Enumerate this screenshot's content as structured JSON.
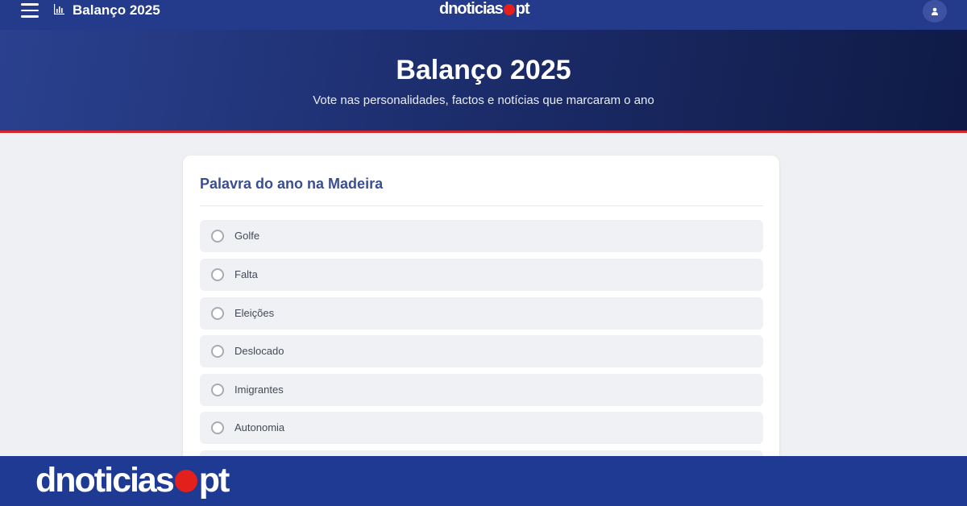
{
  "topbar": {
    "title": "Balanço 2025",
    "logo_left": "dnoticias",
    "logo_right": "pt",
    "icons": {
      "menu": "menu-icon",
      "chart": "bar-chart-icon",
      "user": "user-icon"
    }
  },
  "hero": {
    "title": "Balanço 2025",
    "subtitle": "Vote nas personalidades, factos e notícias que marcaram o ano"
  },
  "poll": {
    "question": "Palavra do ano na Madeira",
    "options": [
      "Golfe",
      "Falta",
      "Eleições",
      "Deslocado",
      "Imigrantes",
      "Autonomia"
    ]
  },
  "footer": {
    "logo_left": "dnoticias",
    "logo_right": "pt"
  },
  "colors": {
    "brand_blue": "#243a8a",
    "accent_red": "#e3201b",
    "title_blue": "#3a4f8f"
  }
}
